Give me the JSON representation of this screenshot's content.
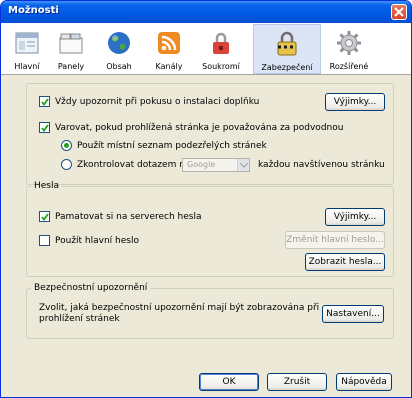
{
  "window": {
    "title": "Možnosti"
  },
  "tabs": [
    {
      "label": "Hlavní",
      "icon": "general-icon"
    },
    {
      "label": "Panely",
      "icon": "tabs-icon"
    },
    {
      "label": "Obsah",
      "icon": "globe-icon"
    },
    {
      "label": "Kanály",
      "icon": "rss-icon"
    },
    {
      "label": "Soukromí",
      "icon": "lock-icon"
    },
    {
      "label": "Zabezpečení",
      "icon": "security-icon",
      "selected": true
    },
    {
      "label": "Rozšířené",
      "icon": "gear-icon"
    }
  ],
  "addons": {
    "warn_install_label": "Vždy upozornit při pokusu o instalaci doplňku",
    "warn_install_checked": true,
    "exceptions_button": "Výjimky..."
  },
  "fraud": {
    "label": "Varovat, pokud prohlížená stránka je považována za podvodnou",
    "checked": true,
    "radio_local_label": "Použít místní seznam podezřelých stránek",
    "radio_local_selected": true,
    "radio_remote_label": "Zkontrolovat dotazem na",
    "radio_remote_selected": false,
    "provider_select_value": "Google",
    "radio_remote_suffix": "každou navštívenou stránku"
  },
  "passwords": {
    "legend": "Hesla",
    "remember_label": "Pamatovat si na serverech hesla",
    "remember_checked": true,
    "exceptions_button": "Výjimky...",
    "master_label": "Použít hlavní heslo",
    "master_checked": false,
    "change_master_button": "Změnit hlavní heslo...",
    "show_passwords_button": "Zobrazit hesla..."
  },
  "warnings": {
    "legend": "Bezpečnostní upozornění",
    "description_line1": "Zvolit, jaká bezpečnostní upozornění mají být zobrazována při",
    "description_line2": "prohlížení stránek",
    "settings_button": "Nastavení..."
  },
  "footer": {
    "ok_button": "OK",
    "cancel_button": "Zrušit",
    "help_button": "Nápověda"
  }
}
